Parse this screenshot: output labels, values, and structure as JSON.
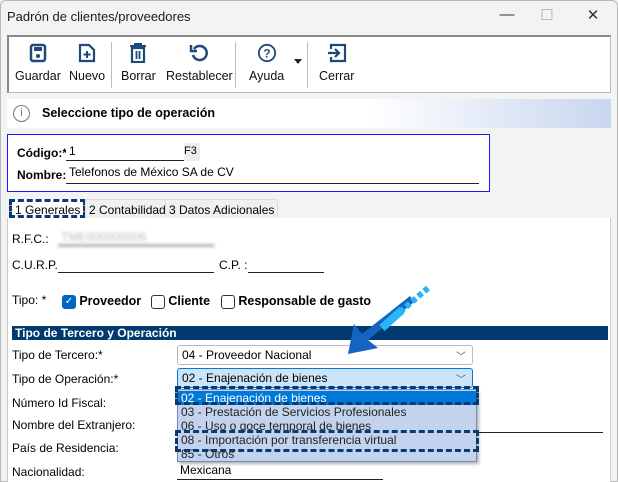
{
  "window": {
    "title": "Padrón de clientes/proveedores",
    "minimize": "—",
    "maximize": "☐",
    "close": "✕"
  },
  "toolbar": {
    "guardar": "Guardar",
    "nuevo": "Nuevo",
    "borrar": "Borrar",
    "restablecer": "Restablecer",
    "ayuda": "Ayuda",
    "cerrar": "Cerrar"
  },
  "banner": {
    "message": "Seleccione tipo de operación",
    "icon": "info-icon"
  },
  "header": {
    "codigo_label": "Código:*",
    "codigo_value": "1",
    "f3": "F3",
    "nombre_label": "Nombre:*",
    "nombre_value": "Telefonos de México SA de CV"
  },
  "tabs": [
    "1 Generales",
    "2 Contabilidad",
    "3 Datos Adicionales"
  ],
  "generales": {
    "rfc_label": "R.F.C.:",
    "rfc_value": "TME000000006",
    "curp_label": "C.U.R.P.:",
    "cp_label": "C.P. :",
    "tipo_label": "Tipo: *",
    "proveedor": "Proveedor",
    "cliente": "Cliente",
    "responsable": "Responsable de gasto",
    "proveedor_checked": true,
    "cliente_checked": false,
    "responsable_checked": false
  },
  "section": {
    "title": "Tipo de Tercero y Operación",
    "tercero_label": "Tipo de Tercero:*",
    "tercero_value": "04 - Proveedor Nacional",
    "operacion_label": "Tipo de Operación:*",
    "operacion_value": "02 - Enajenación de bienes",
    "id_fiscal_label": "Número Id Fiscal:",
    "extranjero_label": "Nombre del Extranjero:",
    "pais_label": "País de Residencia:",
    "nacionalidad_label": "Nacionalidad:",
    "nacionalidad_value": "Mexicana",
    "options": [
      "02 - Enajenación de bienes",
      "03 - Prestación de Servicios Profesionales",
      "06 - Uso o goce temporal de bienes",
      "08 - Importación por transferencia virtual",
      "85 - Otros"
    ]
  },
  "colors": {
    "accent": "#0078d7",
    "section": "#003a70",
    "highlight": "#0b3a6e"
  }
}
